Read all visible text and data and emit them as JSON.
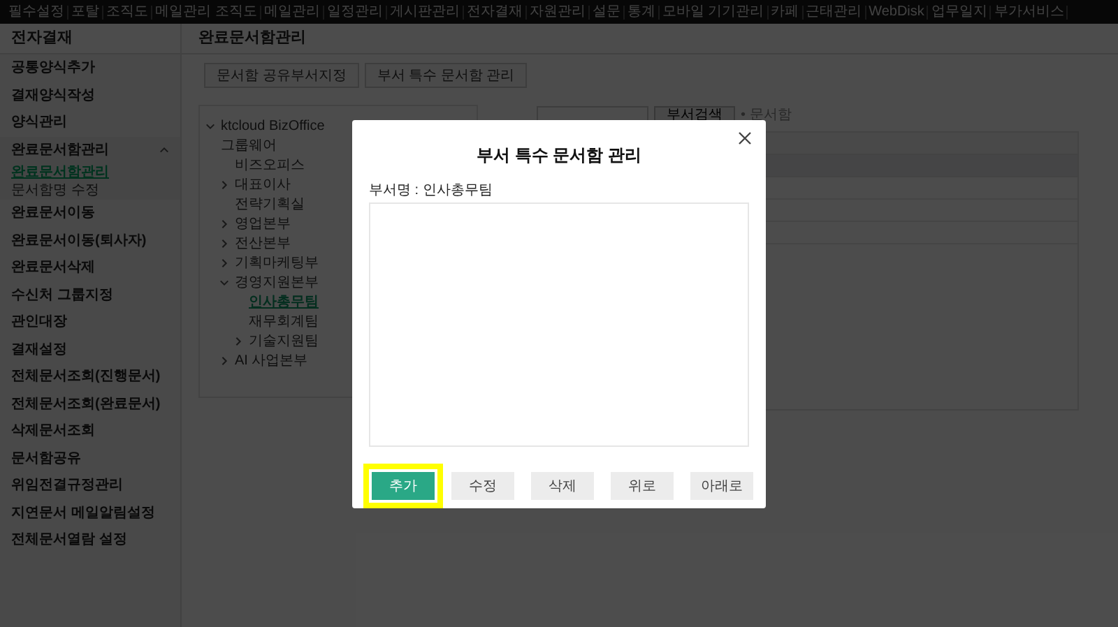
{
  "top_nav": {
    "items": [
      "필수설정",
      "포탈",
      "조직도",
      "메일관리 조직도",
      "메일관리",
      "일정관리",
      "게시판관리",
      "전자결재",
      "자원관리",
      "설문",
      "통계",
      "모바일 기기관리",
      "카페",
      "근태관리",
      "WebDisk",
      "업무일지",
      "부가서비스"
    ]
  },
  "sidebar": {
    "title": "전자결재",
    "items": [
      {
        "label": "공통양식추가"
      },
      {
        "label": "결재양식작성"
      },
      {
        "label": "양식관리"
      },
      {
        "label": "완료문서함관리",
        "expanded": true,
        "children": [
          {
            "label": "완료문서함관리",
            "selected": true
          },
          {
            "label": "문서함명 수정",
            "selected": false
          }
        ]
      },
      {
        "label": "완료문서이동"
      },
      {
        "label": "완료문서이동(퇴사자)"
      },
      {
        "label": "완료문서삭제"
      },
      {
        "label": "수신처 그룹지정"
      },
      {
        "label": "관인대장"
      },
      {
        "label": "결재설정"
      },
      {
        "label": "전체문서조회(진행문서)"
      },
      {
        "label": "전체문서조회(완료문서)"
      },
      {
        "label": "삭제문서조회"
      },
      {
        "label": "문서함공유"
      },
      {
        "label": "위임전결규정관리"
      },
      {
        "label": "지연문서 메일알림설정"
      },
      {
        "label": "전체문서열람 설정"
      }
    ]
  },
  "content": {
    "title": "완료문서함관리",
    "tabs": [
      {
        "label": "문서함 공유부서지정"
      },
      {
        "label": "부서 특수 문서함 관리"
      }
    ],
    "search": {
      "button": "부서검색",
      "hint": "• 문서함"
    },
    "tree": [
      {
        "label": "ktcloud BizOffice 그룹웨어",
        "expanded": true,
        "selected": false,
        "children": [
          {
            "label": "비즈오피스",
            "selected": false
          },
          {
            "label": "대표이사",
            "expanded": false,
            "selected": false
          },
          {
            "label": "전략기획실",
            "selected": false
          },
          {
            "label": "영업본부",
            "expanded": false,
            "selected": false
          },
          {
            "label": "전산본부",
            "expanded": false,
            "selected": false
          },
          {
            "label": "기획마케팅부",
            "expanded": false,
            "selected": false
          },
          {
            "label": "경영지원본부",
            "expanded": true,
            "selected": false,
            "children": [
              {
                "label": "인사총무팀",
                "selected": true
              },
              {
                "label": "재무회계팀",
                "selected": false
              },
              {
                "label": "기술지원팀",
                "expanded": false,
                "selected": false
              }
            ]
          },
          {
            "label": "AI 사업본부",
            "expanded": false,
            "selected": false
          }
        ]
      }
    ]
  },
  "modal": {
    "title": "부서 특수 문서함 관리",
    "department_label": "부서명 : 인사총무팀",
    "buttons": [
      {
        "label": "추가",
        "kind": "primary",
        "highlighted": true
      },
      {
        "label": "수정",
        "kind": "secondary",
        "highlighted": false
      },
      {
        "label": "삭제",
        "kind": "secondary",
        "highlighted": false
      },
      {
        "label": "위로",
        "kind": "secondary",
        "highlighted": false
      },
      {
        "label": "아래로",
        "kind": "secondary",
        "highlighted": false
      }
    ]
  }
}
